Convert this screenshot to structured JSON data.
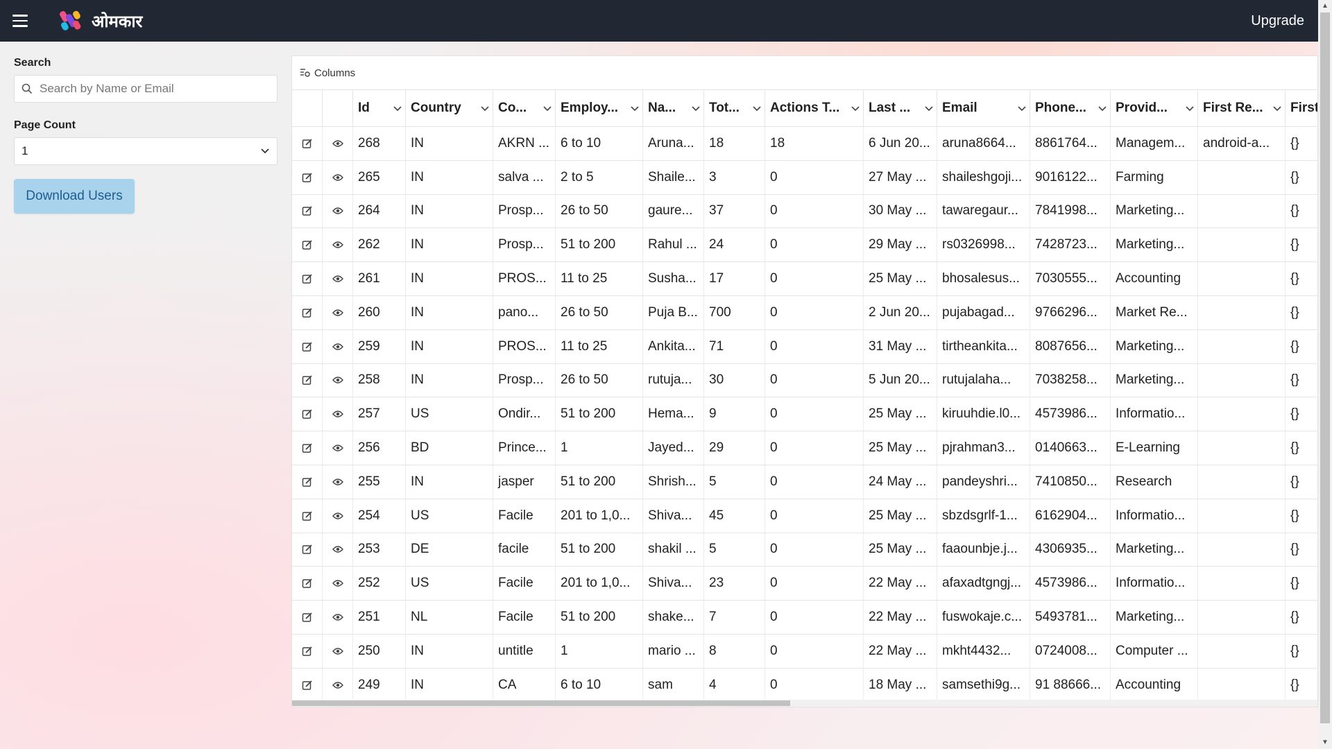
{
  "header": {
    "brand": "ओमकार",
    "upgrade_label": "Upgrade"
  },
  "sidebar": {
    "search_label": "Search",
    "search_placeholder": "Search by Name or Email",
    "page_count_label": "Page Count",
    "page_count_value": "1",
    "download_label": "Download Users"
  },
  "grid": {
    "columns_label": "Columns",
    "headers": [
      "Id",
      "Country",
      "Co...",
      "Employ...",
      "Na...",
      "Tot...",
      "Actions T...",
      "Last ...",
      "Email",
      "Phone...",
      "Provid...",
      "First Re...",
      "First"
    ],
    "rows": [
      [
        "268",
        "IN",
        "AKRN ...",
        "6 to 10",
        "Aruna...",
        "18",
        "18",
        "6 Jun 20...",
        "aruna8664...",
        "8861764...",
        "Managem...",
        "android-a...",
        "{}"
      ],
      [
        "265",
        "IN",
        "salva ...",
        "2 to 5",
        "Shaile...",
        "3",
        "0",
        "27 May ...",
        "shaileshgoji...",
        "9016122...",
        "Farming",
        "",
        "{}"
      ],
      [
        "264",
        "IN",
        "Prosp...",
        "26 to 50",
        "gaure...",
        "37",
        "0",
        "30 May ...",
        "tawaregaur...",
        "7841998...",
        "Marketing...",
        "",
        "{}"
      ],
      [
        "262",
        "IN",
        "Prosp...",
        "51 to 200",
        "Rahul ...",
        "24",
        "0",
        "29 May ...",
        "rs0326998...",
        "7428723...",
        "Marketing...",
        "",
        "{}"
      ],
      [
        "261",
        "IN",
        "PROS...",
        "11 to 25",
        "Susha...",
        "17",
        "0",
        "25 May ...",
        "bhosalesus...",
        "7030555...",
        "Accounting",
        "",
        "{}"
      ],
      [
        "260",
        "IN",
        "pano...",
        "26 to 50",
        "Puja B...",
        "700",
        "0",
        "2 Jun 20...",
        "pujabagad...",
        "9766296...",
        "Market Re...",
        "",
        "{}"
      ],
      [
        "259",
        "IN",
        "PROS...",
        "11 to 25",
        "Ankita...",
        "71",
        "0",
        "31 May ...",
        "tirtheankita...",
        "8087656...",
        "Marketing...",
        "",
        "{}"
      ],
      [
        "258",
        "IN",
        "Prosp...",
        "26 to 50",
        "rutuja...",
        "30",
        "0",
        "5 Jun 20...",
        "rutujalaha...",
        "7038258...",
        "Marketing...",
        "",
        "{}"
      ],
      [
        "257",
        "US",
        "Ondir...",
        "51 to 200",
        "Hema...",
        "9",
        "0",
        "25 May ...",
        "kiruuhdie.l0...",
        "4573986...",
        "Informatio...",
        "",
        "{}"
      ],
      [
        "256",
        "BD",
        "Prince...",
        "1",
        "Jayed...",
        "29",
        "0",
        "25 May ...",
        "pjrahman3...",
        "0140663...",
        "E-Learning",
        "",
        "{}"
      ],
      [
        "255",
        "IN",
        "jasper",
        "51 to 200",
        "Shrish...",
        "5",
        "0",
        "24 May ...",
        "pandeyshri...",
        "7410850...",
        "Research",
        "",
        "{}"
      ],
      [
        "254",
        "US",
        "Facile",
        "201 to 1,0...",
        "Shiva...",
        "45",
        "0",
        "25 May ...",
        "sbzdsgrlf-1...",
        "6162904...",
        "Informatio...",
        "",
        "{}"
      ],
      [
        "253",
        "DE",
        "facile",
        "51 to 200",
        "shakil ...",
        "5",
        "0",
        "25 May ...",
        "faaounbje.j...",
        "4306935...",
        "Marketing...",
        "",
        "{}"
      ],
      [
        "252",
        "US",
        "Facile",
        "201 to 1,0...",
        "Shiva...",
        "23",
        "0",
        "22 May ...",
        "afaxadtgngj...",
        "4573986...",
        "Informatio...",
        "",
        "{}"
      ],
      [
        "251",
        "NL",
        "Facile",
        "51 to 200",
        "shake...",
        "7",
        "0",
        "22 May ...",
        "fuswokaje.c...",
        "5493781...",
        "Marketing...",
        "",
        "{}"
      ],
      [
        "250",
        "IN",
        "untitle",
        "1",
        "mario ...",
        "8",
        "0",
        "22 May ...",
        "mkht4432...",
        "0724008...",
        "Computer ...",
        "",
        "{}"
      ],
      [
        "249",
        "IN",
        "CA",
        "6 to 10",
        "sam",
        "4",
        "0",
        "18 May ...",
        "samsethi9g...",
        "91 88666...",
        "Accounting",
        "",
        "{}"
      ]
    ],
    "horizontal_scroll_fraction": 0.485
  },
  "icons": {
    "menu": "hamburger-icon",
    "search": "search-icon",
    "select_arrow": "chevron-down-icon",
    "columns": "columns-icon",
    "edit": "edit-icon",
    "view": "eye-icon"
  },
  "colors": {
    "topbar": "#212833",
    "download_button_bg": "#a9d3ec",
    "download_button_text": "#1d5d8f"
  }
}
